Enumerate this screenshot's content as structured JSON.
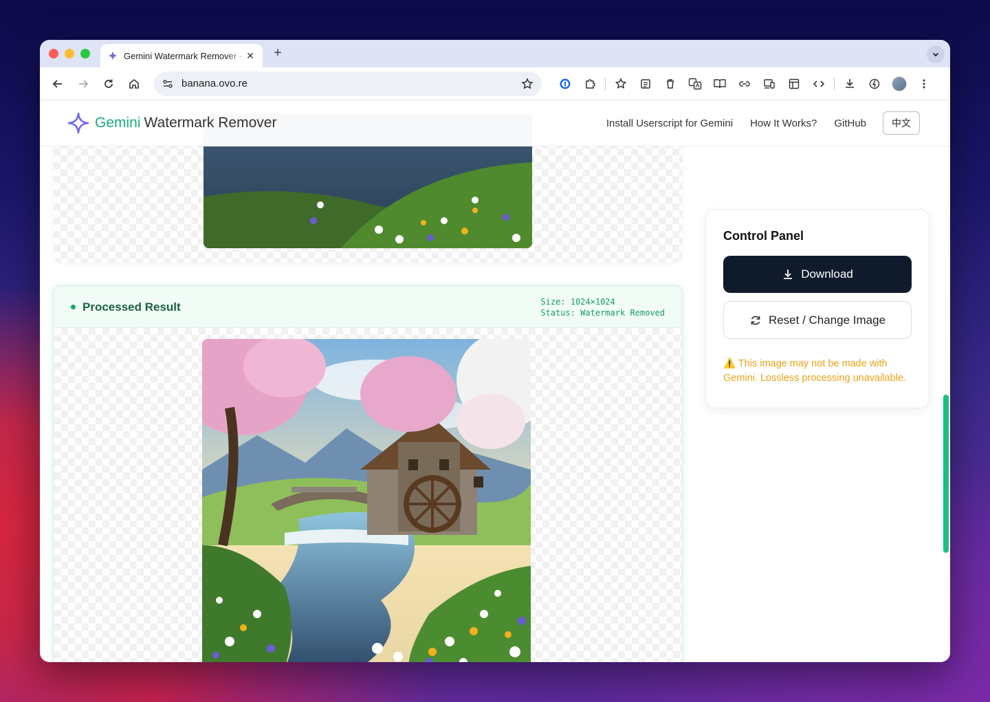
{
  "browser": {
    "tab_title": "Gemini Watermark Remover - Gemini Watermark Remover",
    "tab_close": "✕",
    "new_tab": "+",
    "url": "banana.ovo.re"
  },
  "site": {
    "brand_part1": "Gemini",
    "brand_part2": "Watermark Remover",
    "nav": [
      "Install Userscript for Gemini",
      "How It Works?",
      "GitHub"
    ],
    "lang": "中文"
  },
  "result": {
    "title": "Processed Result",
    "size": "Size: 1024×1024",
    "status": "Status: Watermark Removed"
  },
  "control": {
    "title": "Control Panel",
    "download": "Download",
    "reset": "Reset / Change Image",
    "warning": "⚠️ This image may not be made with Gemini. Lossless processing unavailable."
  },
  "colors": {
    "accent": "#1ba97f",
    "primary_button": "#0f1b2b",
    "warning": "#e8a317"
  }
}
